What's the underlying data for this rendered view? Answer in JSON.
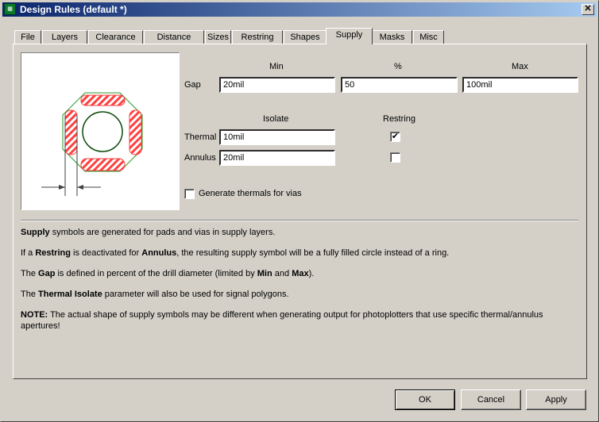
{
  "window": {
    "title": "Design Rules (default *)",
    "close": "✕"
  },
  "tabs": [
    "File",
    "Layers",
    "Clearance",
    "Distance",
    "Sizes",
    "Restring",
    "Shapes",
    "Supply",
    "Masks",
    "Misc"
  ],
  "selected_tab": "Supply",
  "gap": {
    "label": "Gap",
    "min_header": "Min",
    "pct_header": "%",
    "max_header": "Max",
    "min": "20mil",
    "pct": "50",
    "max": "100mil"
  },
  "isolate_header": "Isolate",
  "restring_header": "Restring",
  "thermal": {
    "label": "Thermal",
    "isolate": "10mil",
    "restring": true
  },
  "annulus": {
    "label": "Annulus",
    "isolate": "20mil",
    "restring": false
  },
  "vias": {
    "label": "Generate thermals for vias",
    "checked": false
  },
  "help": [
    [
      {
        "b": "Supply"
      },
      {
        "t": " symbols are generated for pads and vias in supply layers."
      }
    ],
    [
      {
        "t": "If a "
      },
      {
        "b": "Restring"
      },
      {
        "t": " is deactivated for "
      },
      {
        "b": "Annulus"
      },
      {
        "t": ", the resulting supply symbol will be a fully filled circle instead of a ring."
      }
    ],
    [
      {
        "t": "The "
      },
      {
        "b": "Gap"
      },
      {
        "t": " is defined in percent of the drill diameter (limited by "
      },
      {
        "b": "Min"
      },
      {
        "t": " and "
      },
      {
        "b": "Max"
      },
      {
        "t": ")."
      }
    ],
    [
      {
        "t": "The "
      },
      {
        "b": "Thermal Isolate"
      },
      {
        "t": " parameter will also be used for signal polygons."
      }
    ],
    [
      {
        "b": "NOTE:"
      },
      {
        "t": " The actual shape of supply symbols may be different when generating output for photoplotters that use specific thermal/annulus apertures!"
      }
    ]
  ],
  "buttons": {
    "ok": "OK",
    "cancel": "Cancel",
    "apply": "Apply"
  }
}
